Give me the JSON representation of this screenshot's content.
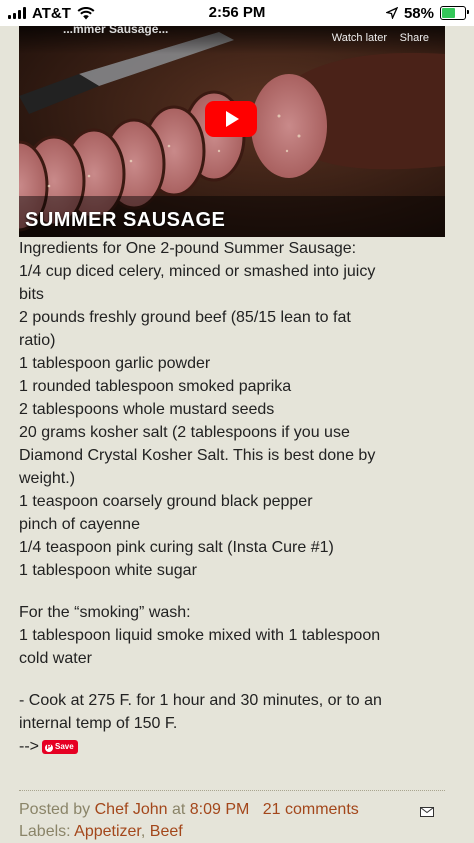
{
  "status_bar": {
    "carrier": "AT&T",
    "time": "2:56 PM",
    "battery_percent": "58%",
    "battery_level": 0.58
  },
  "video": {
    "title_fragment": "...mmer Sausage...",
    "watch_later": "Watch later",
    "share": "Share",
    "caption": "SUMMER SAUSAGE"
  },
  "recipe": {
    "lines": [
      "Ingredients for One 2-pound Summer Sausage:",
      "1/4 cup diced celery, minced or smashed into juicy",
      "bits",
      "2 pounds freshly ground beef (85/15 lean to fat",
      "ratio)",
      "1 tablespoon garlic powder",
      "1 rounded tablespoon smoked paprika",
      "2 tablespoons whole mustard seeds",
      "20 grams kosher salt (2 tablespoons if you use",
      "Diamond Crystal Kosher Salt. This is best done by",
      "weight.)",
      "1 teaspoon coarsely ground black pepper",
      "pinch of cayenne",
      "1/4 teaspoon pink curing salt (Insta Cure #1)",
      "1 tablespoon white sugar"
    ],
    "wash_lines": [
      "For the “smoking” wash:",
      "1 tablespoon liquid smoke mixed with 1 tablespoon",
      "cold water"
    ],
    "cook_lines": [
      "- Cook at 275 F. for 1 hour and 30 minutes, or to an",
      "internal temp of 150 F."
    ],
    "arrow": "-->",
    "save_label": "Save"
  },
  "footer": {
    "posted_by_prefix": "Posted by ",
    "author": "Chef John",
    "at": " at ",
    "time": "8:09 PM",
    "comments": "21 comments",
    "labels_prefix": "Labels: ",
    "label_1": "Appetizer",
    "label_sep": ", ",
    "label_2": "Beef"
  },
  "colors": {
    "page_bg": "#e5e4d9",
    "link": "#a3471b",
    "footer_text": "#8a8468",
    "play_red": "#ff0000",
    "pin_red": "#e60023"
  }
}
